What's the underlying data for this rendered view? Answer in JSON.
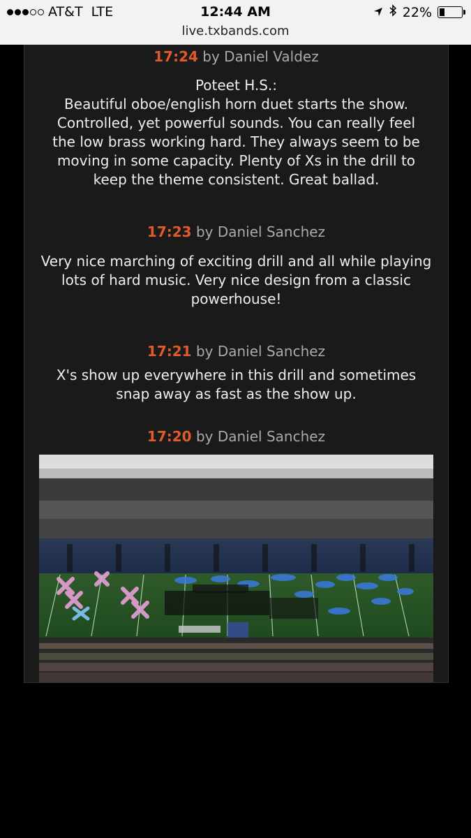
{
  "status_bar": {
    "carrier": "AT&T",
    "network": "LTE",
    "time": "12:44 AM",
    "battery": "22%",
    "battery_level": 0.22,
    "url": "live.txbands.com"
  },
  "icons": [
    "location-arrow-icon",
    "bluetooth-icon",
    "battery-icon",
    "signal-dots-icon"
  ],
  "accent_color": "#e05a2b",
  "entries": [
    {
      "time": "17:24",
      "by": "by Daniel Valdez",
      "lines": [
        "Poteet H.S.:",
        "Beautiful oboe/english horn duet starts the show.",
        "Controlled, yet powerful sounds.  You can really feel",
        "the low brass working hard.  They always seem to be",
        "moving in some capacity.  Plenty of Xs in the drill to",
        "keep the theme consistent.  Great ballad."
      ]
    },
    {
      "time": "17:23",
      "by": "by Daniel Sanchez",
      "lines": [
        "Very nice marching of exciting drill and all while playing",
        "lots of hard music. Very nice design from a classic",
        "powerhouse!"
      ]
    },
    {
      "time": "17:21",
      "by": "by Daniel Sanchez",
      "lines": [
        "X's show up everywhere in this drill and sometimes",
        "snap away as fast as the show up."
      ]
    },
    {
      "time": "17:20",
      "by": "by Daniel Sanchez",
      "lines": []
    }
  ]
}
